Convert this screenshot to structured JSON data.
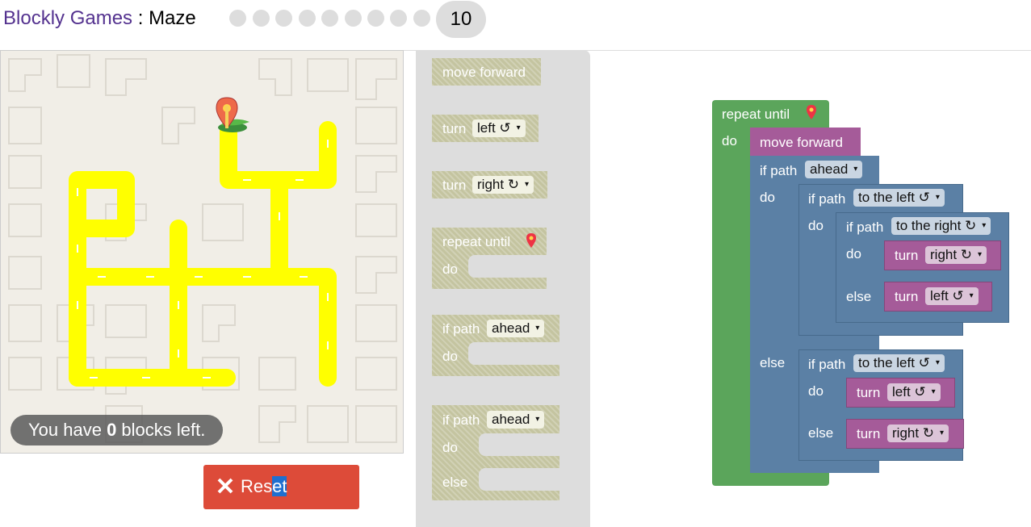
{
  "header": {
    "app_link": "Blockly Games",
    "separator": " : ",
    "page": "Maze",
    "levels": [
      "1",
      "2",
      "3",
      "4",
      "5",
      "6",
      "7",
      "8",
      "9"
    ],
    "current_level": "10"
  },
  "maze": {
    "blocks_left_prefix": "You have ",
    "blocks_left_count": "0",
    "blocks_left_suffix": " blocks left."
  },
  "reset": {
    "label_a": "Res",
    "label_b": "et"
  },
  "toolbox": {
    "move_forward": "move forward",
    "turn": "turn",
    "left": "left ↺",
    "right": "right ↻",
    "repeat_until": "repeat until",
    "do": "do",
    "else": "else",
    "if_path": "if path",
    "ahead": "ahead",
    "arrow": "▾"
  },
  "program": {
    "repeat_until": "repeat until",
    "do": "do",
    "else": "else",
    "move_forward": "move forward",
    "if_path": "if path",
    "turn": "turn",
    "ahead": "ahead",
    "to_the_left": "to the left ↺",
    "to_the_right": "to the right ↻",
    "left": "left ↺",
    "right": "right ↻",
    "arrow": "▾"
  },
  "colors": {
    "loop_block": "#5ba55b",
    "movement_block": "#a55b99",
    "logic_block": "#5b80a5",
    "path": "#ffff00",
    "reset_button": "#dd4b39",
    "title_link": "#54328f"
  }
}
